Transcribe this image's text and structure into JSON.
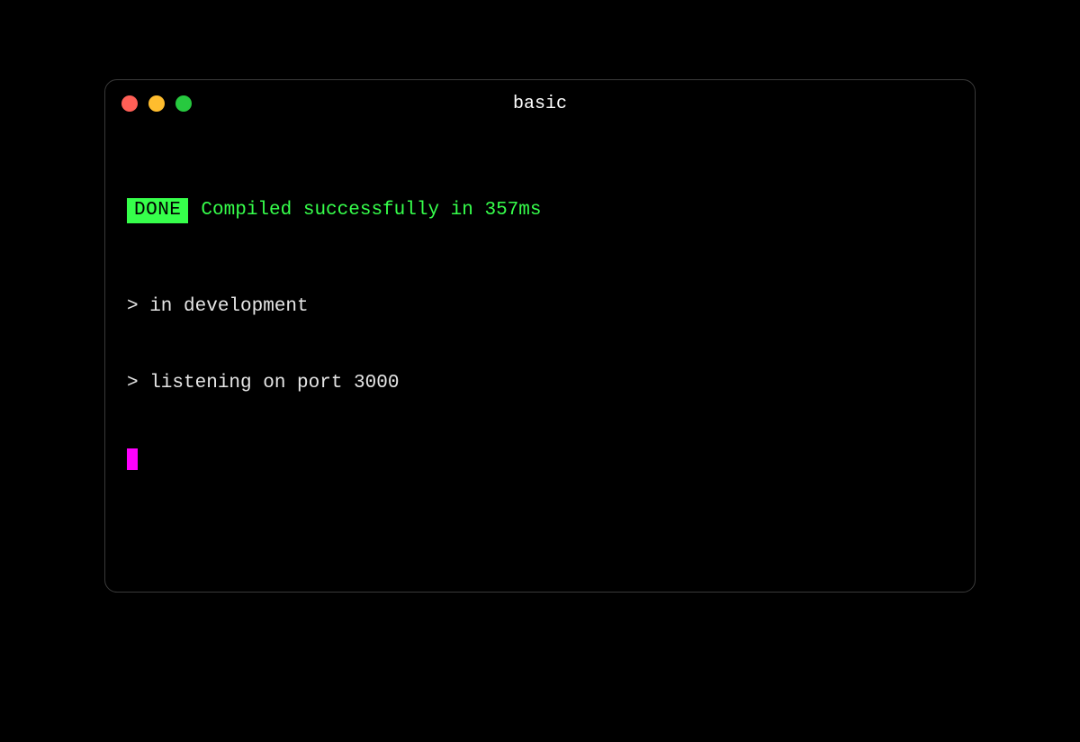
{
  "window": {
    "title": "basic"
  },
  "status": {
    "badge": "DONE",
    "message": "Compiled successfully in 357ms"
  },
  "output": {
    "line1": "> in development",
    "line2": "> listening on port 3000"
  },
  "colors": {
    "close": "#ff5f56",
    "minimize": "#ffbd2e",
    "zoom": "#27c93f",
    "success": "#36ff4b",
    "cursor": "#ff00ff"
  }
}
